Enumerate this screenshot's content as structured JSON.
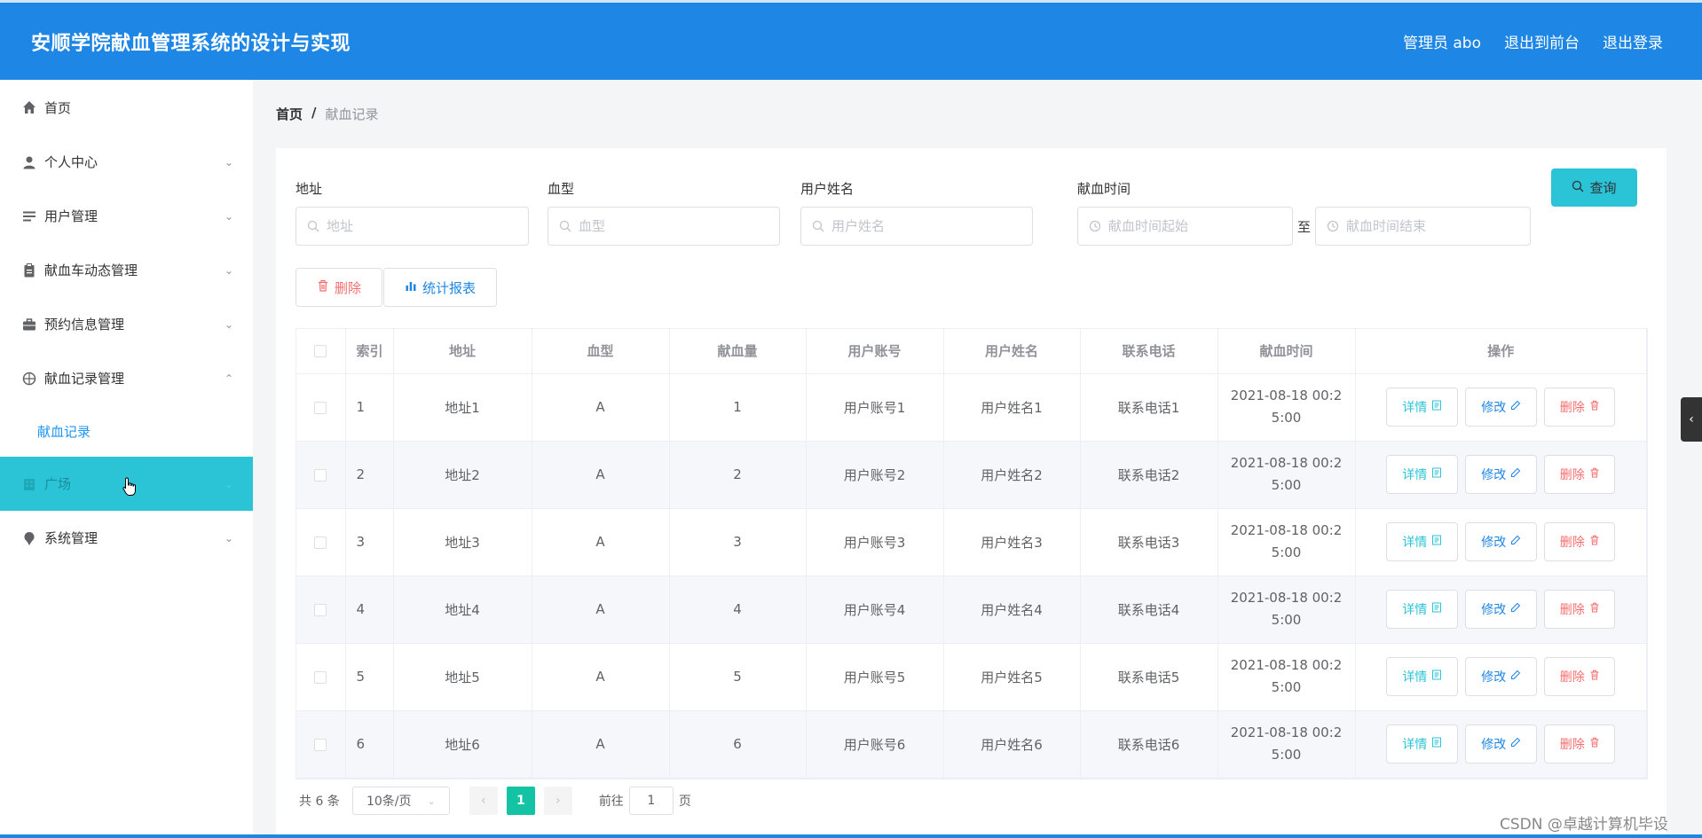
{
  "header": {
    "title": "安顺学院献血管理系统的设计与实现",
    "admin_label": "管理员 abo",
    "exit_front_label": "退出到前台",
    "logout_label": "退出登录"
  },
  "sidebar": {
    "items": [
      {
        "label": "首页",
        "icon": "home-icon"
      },
      {
        "label": "个人中心",
        "icon": "user-icon"
      },
      {
        "label": "用户管理",
        "icon": "list-icon"
      },
      {
        "label": "献血车动态管理",
        "icon": "clipboard-icon"
      },
      {
        "label": "预约信息管理",
        "icon": "briefcase-icon"
      },
      {
        "label": "献血记录管理",
        "icon": "compass-icon"
      },
      {
        "label": "广场",
        "icon": "building-icon"
      },
      {
        "label": "系统管理",
        "icon": "pin-icon"
      }
    ],
    "submenu_label": "献血记录"
  },
  "breadcrumb": {
    "home": "首页",
    "sep": "/",
    "current": "献血记录"
  },
  "search": {
    "address_label": "地址",
    "address_placeholder": "地址",
    "blood_type_label": "血型",
    "blood_type_placeholder": "血型",
    "username_label": "用户姓名",
    "username_placeholder": "用户姓名",
    "time_label": "献血时间",
    "time_start_placeholder": "献血时间起始",
    "time_range_sep": "至",
    "time_end_placeholder": "献血时间结束",
    "query_label": "查询"
  },
  "actions": {
    "delete_label": "删除",
    "report_label": "统计报表"
  },
  "table": {
    "headers": [
      "索引",
      "地址",
      "血型",
      "献血量",
      "用户账号",
      "用户姓名",
      "联系电话",
      "献血时间",
      "操作"
    ],
    "rows": [
      [
        "1",
        "地址1",
        "A",
        "1",
        "用户账号1",
        "用户姓名1",
        "联系电话1",
        "2021-08-18 00:25:00"
      ],
      [
        "2",
        "地址2",
        "A",
        "2",
        "用户账号2",
        "用户姓名2",
        "联系电话2",
        "2021-08-18 00:25:00"
      ],
      [
        "3",
        "地址3",
        "A",
        "3",
        "用户账号3",
        "用户姓名3",
        "联系电话3",
        "2021-08-18 00:25:00"
      ],
      [
        "4",
        "地址4",
        "A",
        "4",
        "用户账号4",
        "用户姓名4",
        "联系电话4",
        "2021-08-18 00:25:00"
      ],
      [
        "5",
        "地址5",
        "A",
        "5",
        "用户账号5",
        "用户姓名5",
        "联系电话5",
        "2021-08-18 00:25:00"
      ],
      [
        "6",
        "地址6",
        "A",
        "6",
        "用户账号6",
        "用户姓名6",
        "联系电话6",
        "2021-08-18 00:25:00"
      ]
    ],
    "op_detail": "详情",
    "op_edit": "修改",
    "op_delete": "删除"
  },
  "pagination": {
    "total": "共 6 条",
    "page_size": "10条/页",
    "current_page": "1",
    "goto_prefix": "前往",
    "goto_value": "1",
    "goto_suffix": "页"
  },
  "watermark": "CSDN @卓越计算机毕设",
  "colors": {
    "primary": "#1e86e4",
    "accent": "#2bc3d6",
    "danger": "#f56c6c",
    "page_active": "#13c3a4"
  }
}
